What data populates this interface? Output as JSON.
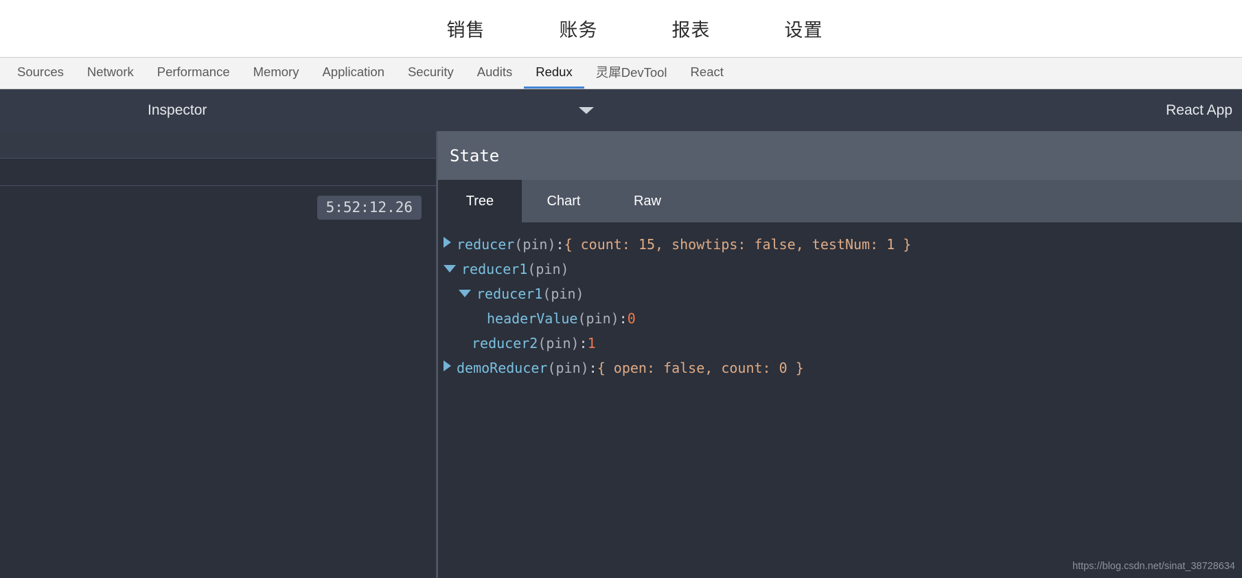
{
  "site_nav": {
    "items": [
      {
        "label": "销售"
      },
      {
        "label": "账务"
      },
      {
        "label": "报表"
      },
      {
        "label": "设置"
      }
    ]
  },
  "devtools_tabs": {
    "items": [
      {
        "label": "Sources",
        "active": false
      },
      {
        "label": "Network",
        "active": false
      },
      {
        "label": "Performance",
        "active": false
      },
      {
        "label": "Memory",
        "active": false
      },
      {
        "label": "Application",
        "active": false
      },
      {
        "label": "Security",
        "active": false
      },
      {
        "label": "Audits",
        "active": false
      },
      {
        "label": "Redux",
        "active": true
      },
      {
        "label": "灵犀DevTool",
        "active": false
      },
      {
        "label": "React",
        "active": false
      }
    ]
  },
  "inspector_bar": {
    "title": "Inspector",
    "dropdown_icon": "chevron-down-icon",
    "app_name": "React App"
  },
  "action_list": {
    "timestamp": "5:52:12.26"
  },
  "state_panel": {
    "header_title": "State",
    "tabs": [
      {
        "label": "Tree",
        "active": true
      },
      {
        "label": "Chart",
        "active": false
      },
      {
        "label": "Raw",
        "active": false
      }
    ],
    "tree": [
      {
        "indent": 0,
        "toggle": "collapsed",
        "key": "reducer",
        "pin": " (pin)",
        "punc": ": ",
        "preview": "{ count: 15, showtips: false, testNum: 1 }",
        "value": ""
      },
      {
        "indent": 0,
        "toggle": "expanded",
        "key": "reducer1",
        "pin": " (pin)",
        "punc": "",
        "preview": "",
        "value": ""
      },
      {
        "indent": 1,
        "toggle": "expanded",
        "key": "reducer1",
        "pin": " (pin)",
        "punc": "",
        "preview": "",
        "value": ""
      },
      {
        "indent": 2,
        "toggle": "none",
        "key": "headerValue",
        "pin": " (pin)",
        "punc": ": ",
        "preview": "",
        "value": "0"
      },
      {
        "indent": 1,
        "toggle": "none",
        "key": "reducer2",
        "pin": " (pin)",
        "punc": ": ",
        "preview": "",
        "value": "1"
      },
      {
        "indent": 0,
        "toggle": "collapsed",
        "key": "demoReducer",
        "pin": " (pin)",
        "punc": ": ",
        "preview": "{ open: false, count: 0 }",
        "value": ""
      }
    ]
  },
  "watermark": {
    "text": "https://blog.csdn.net/sinat_38728634"
  },
  "colors": {
    "accent_tab": "#4285d6",
    "panel_dark": "#2b303b",
    "panel_mid": "#4e5563",
    "panel_header": "#575e6c",
    "key_blue": "#7cc1e0",
    "value_orange": "#f07a4b"
  }
}
